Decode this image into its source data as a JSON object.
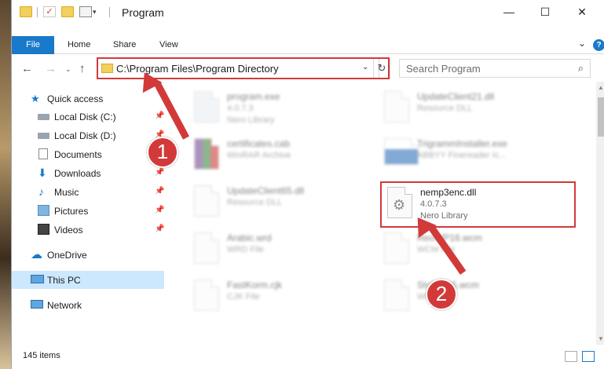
{
  "title": {
    "window_title": "Program"
  },
  "window_controls": {
    "minimize": "—",
    "maximize": "☐",
    "close": "✕"
  },
  "ribbon": {
    "tabs": [
      {
        "label": "File"
      },
      {
        "label": "Home"
      },
      {
        "label": "Share"
      },
      {
        "label": "View"
      }
    ],
    "help": "?"
  },
  "address": {
    "path": "C:\\Program Files\\Program Directory",
    "search_placeholder": "Search Program"
  },
  "sidebar": {
    "items": [
      {
        "label": "Quick access"
      },
      {
        "label": "Local Disk (C:)"
      },
      {
        "label": "Local Disk (D:)"
      },
      {
        "label": "Documents"
      },
      {
        "label": "Downloads"
      },
      {
        "label": "Music"
      },
      {
        "label": "Pictures"
      },
      {
        "label": "Videos"
      },
      {
        "label": "OneDrive"
      },
      {
        "label": "This PC"
      },
      {
        "label": "Network"
      }
    ]
  },
  "files": [
    {
      "name": "program.exe",
      "line2": "4.0.7.3",
      "line3": "Nero Library"
    },
    {
      "name": "UpdateClient21.dll",
      "line2": "Resource DLL",
      "line3": ""
    },
    {
      "name": "certificates.cab",
      "line2": "WinRAR Archive",
      "line3": ""
    },
    {
      "name": "TrigrammInstaller.exe",
      "line2": "ABBYY Finereader Ic...",
      "line3": ""
    },
    {
      "name": "UpdateClient65.dll",
      "line2": "Resource DLL",
      "line3": ""
    },
    {
      "name": "nemp3enc.dll",
      "line2": "4.0.7.3",
      "line3": "Nero Library"
    },
    {
      "name": "Arabic.wrd",
      "line2": "WRD File",
      "line3": ""
    },
    {
      "name": "ReoWP16.wcm",
      "line2": "WCM File",
      "line3": ""
    },
    {
      "name": "FastKorm.cjk",
      "line2": "CJK File",
      "line3": ""
    },
    {
      "name": "StoWP15.wcm",
      "line2": "WCM File",
      "line3": ""
    }
  ],
  "status": {
    "items_count": "145 items"
  },
  "annotations": {
    "step1": "1",
    "step2": "2"
  },
  "colors": {
    "accent": "#1979ca",
    "highlight": "#d23a3a",
    "selected_bg": "#cce8ff"
  }
}
